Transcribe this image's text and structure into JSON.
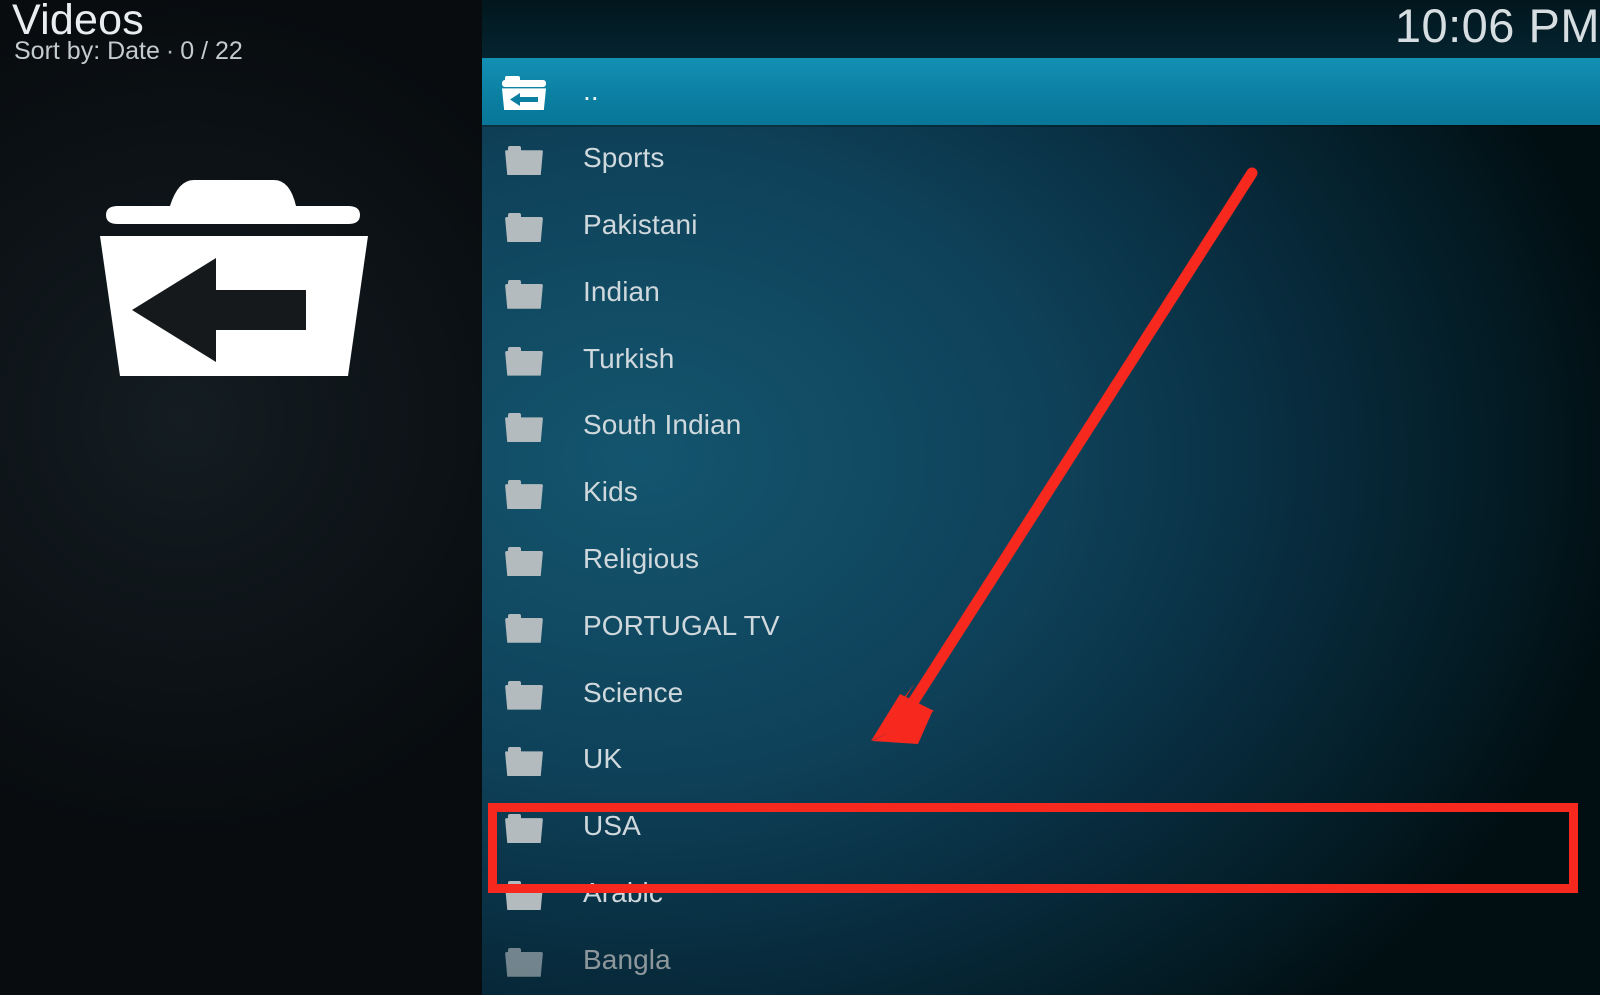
{
  "window": {
    "app": "Kodi",
    "section_title": "Videos",
    "sort_label": "Sort by: Date",
    "separator": "·",
    "item_counter": "0 / 22",
    "clock": "10:06 PM"
  },
  "sidebar": {
    "artwork_icon": "parent-folder-back-icon"
  },
  "file_list": {
    "items": [
      {
        "label": "..",
        "icon": "parent-folder-back-icon",
        "selected": true,
        "dimmed": false
      },
      {
        "label": "Sports",
        "icon": "folder-icon",
        "selected": false,
        "dimmed": false
      },
      {
        "label": "Pakistani",
        "icon": "folder-icon",
        "selected": false,
        "dimmed": false
      },
      {
        "label": "Indian",
        "icon": "folder-icon",
        "selected": false,
        "dimmed": false
      },
      {
        "label": "Turkish",
        "icon": "folder-icon",
        "selected": false,
        "dimmed": false
      },
      {
        "label": "South Indian",
        "icon": "folder-icon",
        "selected": false,
        "dimmed": false
      },
      {
        "label": "Kids",
        "icon": "folder-icon",
        "selected": false,
        "dimmed": false
      },
      {
        "label": "Religious",
        "icon": "folder-icon",
        "selected": false,
        "dimmed": false
      },
      {
        "label": "PORTUGAL TV",
        "icon": "folder-icon",
        "selected": false,
        "dimmed": false
      },
      {
        "label": "Science",
        "icon": "folder-icon",
        "selected": false,
        "dimmed": false
      },
      {
        "label": "UK",
        "icon": "folder-icon",
        "selected": false,
        "dimmed": false
      },
      {
        "label": "USA",
        "icon": "folder-icon",
        "selected": false,
        "dimmed": false
      },
      {
        "label": "Arabic",
        "icon": "folder-icon",
        "selected": false,
        "dimmed": false
      },
      {
        "label": "Bangla",
        "icon": "folder-icon",
        "selected": false,
        "dimmed": true
      }
    ]
  },
  "annotations": {
    "highlight_color": "#f7291f",
    "highlight_target": "USA",
    "arrow_color": "#f7291f",
    "arrow_points_to": "USA"
  },
  "colors": {
    "selected_row": "#0b7fa2",
    "panel_background": "#0e4159",
    "sidebar_background": "#0d1317",
    "folder_icon": "#b3bbbf",
    "text_primary": "#cfd8dc",
    "title_text": "#e9edef"
  }
}
